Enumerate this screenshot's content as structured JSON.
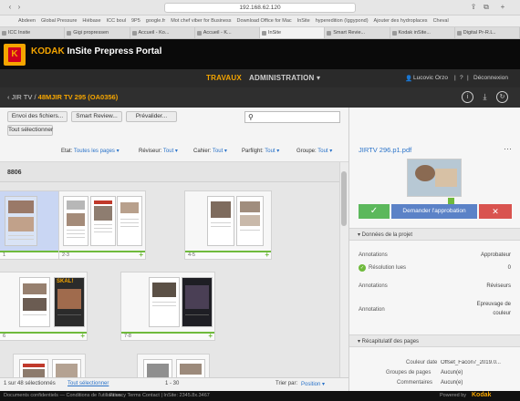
{
  "browser": {
    "url": "192.168.62.120",
    "bookmarks": [
      "Abdeen",
      "Global Pressure",
      "Hiébase",
      "ICC boul",
      "9P5",
      "google.fr",
      "Mot chef viber for Business",
      "Download Office for Mac",
      "InSite",
      "hyperedition (Iggypond)",
      "Ajouter des hydroplaces",
      "Cheval"
    ],
    "tabs": [
      "ICC Insite",
      "Gigi propressen",
      "Accueil - Ko...",
      "Accueil - K...",
      "InSite",
      "Smart Revie...",
      "Kodak inSite...",
      "Digital Pr-R.L.."
    ]
  },
  "brand": {
    "name": "KODAK",
    "product": "InSite Prepress Portal",
    "logo_letter": "K"
  },
  "nav": {
    "travaux": "TRAVAUX",
    "administration": "ADMINISTRATION ▾",
    "user": "Lucovic Orzo",
    "help": "?",
    "logout": "Déconnexion"
  },
  "breadcrumb": {
    "back": "‹",
    "parent": "JIR TV",
    "sep": "/",
    "current": "48MJIR TV 295 (OA0356)"
  },
  "header_icons": {
    "info": "i",
    "download": "⤓",
    "history": "↻"
  },
  "toolbar": {
    "btn_envoi": "Envoi des fichiers...",
    "btn_smart": "Smart Review...",
    "btn_prevalider": "Prévalider...",
    "btn_tout": "Tout sélectionner",
    "search_placeholder": ""
  },
  "filters": [
    {
      "label": "Etat:",
      "value": "Toutes les pages ▾"
    },
    {
      "label": "Réviseur:",
      "value": "Tout ▾"
    },
    {
      "label": "Cahier:",
      "value": "Tout ▾"
    },
    {
      "label": "Parfilght:",
      "value": "Tout ▾"
    },
    {
      "label": "Groupe:",
      "value": "Tout ▾"
    }
  ],
  "group": {
    "label": "8806"
  },
  "cards": [
    {
      "num": "1"
    },
    {
      "num": "2-3"
    },
    {
      "num": "4-5"
    },
    {
      "num": "6"
    },
    {
      "num": "7-8"
    },
    {
      "num": ""
    },
    {
      "num": ""
    }
  ],
  "card_badge": "SKAL!",
  "status": {
    "count": "1 sur 48 sélectionnés",
    "select_all": "Tout sélectionner",
    "range": "1 - 30",
    "sort_label": "Trier par:",
    "sort_value": "Position ▾"
  },
  "footer": {
    "left": "Documents confidentiels — Conditions de l'utilisation",
    "mid": "Privacy    Terms    Contact  |  InSite: 2345.8x.3467",
    "powered": "Powered by",
    "powered_brand": "Kodak"
  },
  "right_panel": {
    "file": "JIRTV 296.p1.pdf",
    "dots": "···",
    "ok": "✓",
    "request": "Demander l'approbation",
    "reject": "✕",
    "section1": "▾  Données de la projet",
    "annotations_label": "Annotations",
    "annotations_value": "Approbateur",
    "resolved_label": "Résolution lues",
    "resolved_value": "0",
    "annotations2_label": "Annotations",
    "annotations2_value": "Réviseurs",
    "annotations3_label": "Annotation",
    "annotations3_value_line1": "Epreuvage de",
    "annotations3_value_line2": "couleur",
    "section2": "▾  Récapitulatif des pages",
    "couleur_label": "Couleur date",
    "couleur_value": "Offset_Facon7_2019.0...",
    "groupe_label": "Groupes de pages",
    "groupe_value": "Aucun(e)",
    "comment_label": "Commentaires",
    "comment_value": "Aucun(e)"
  }
}
